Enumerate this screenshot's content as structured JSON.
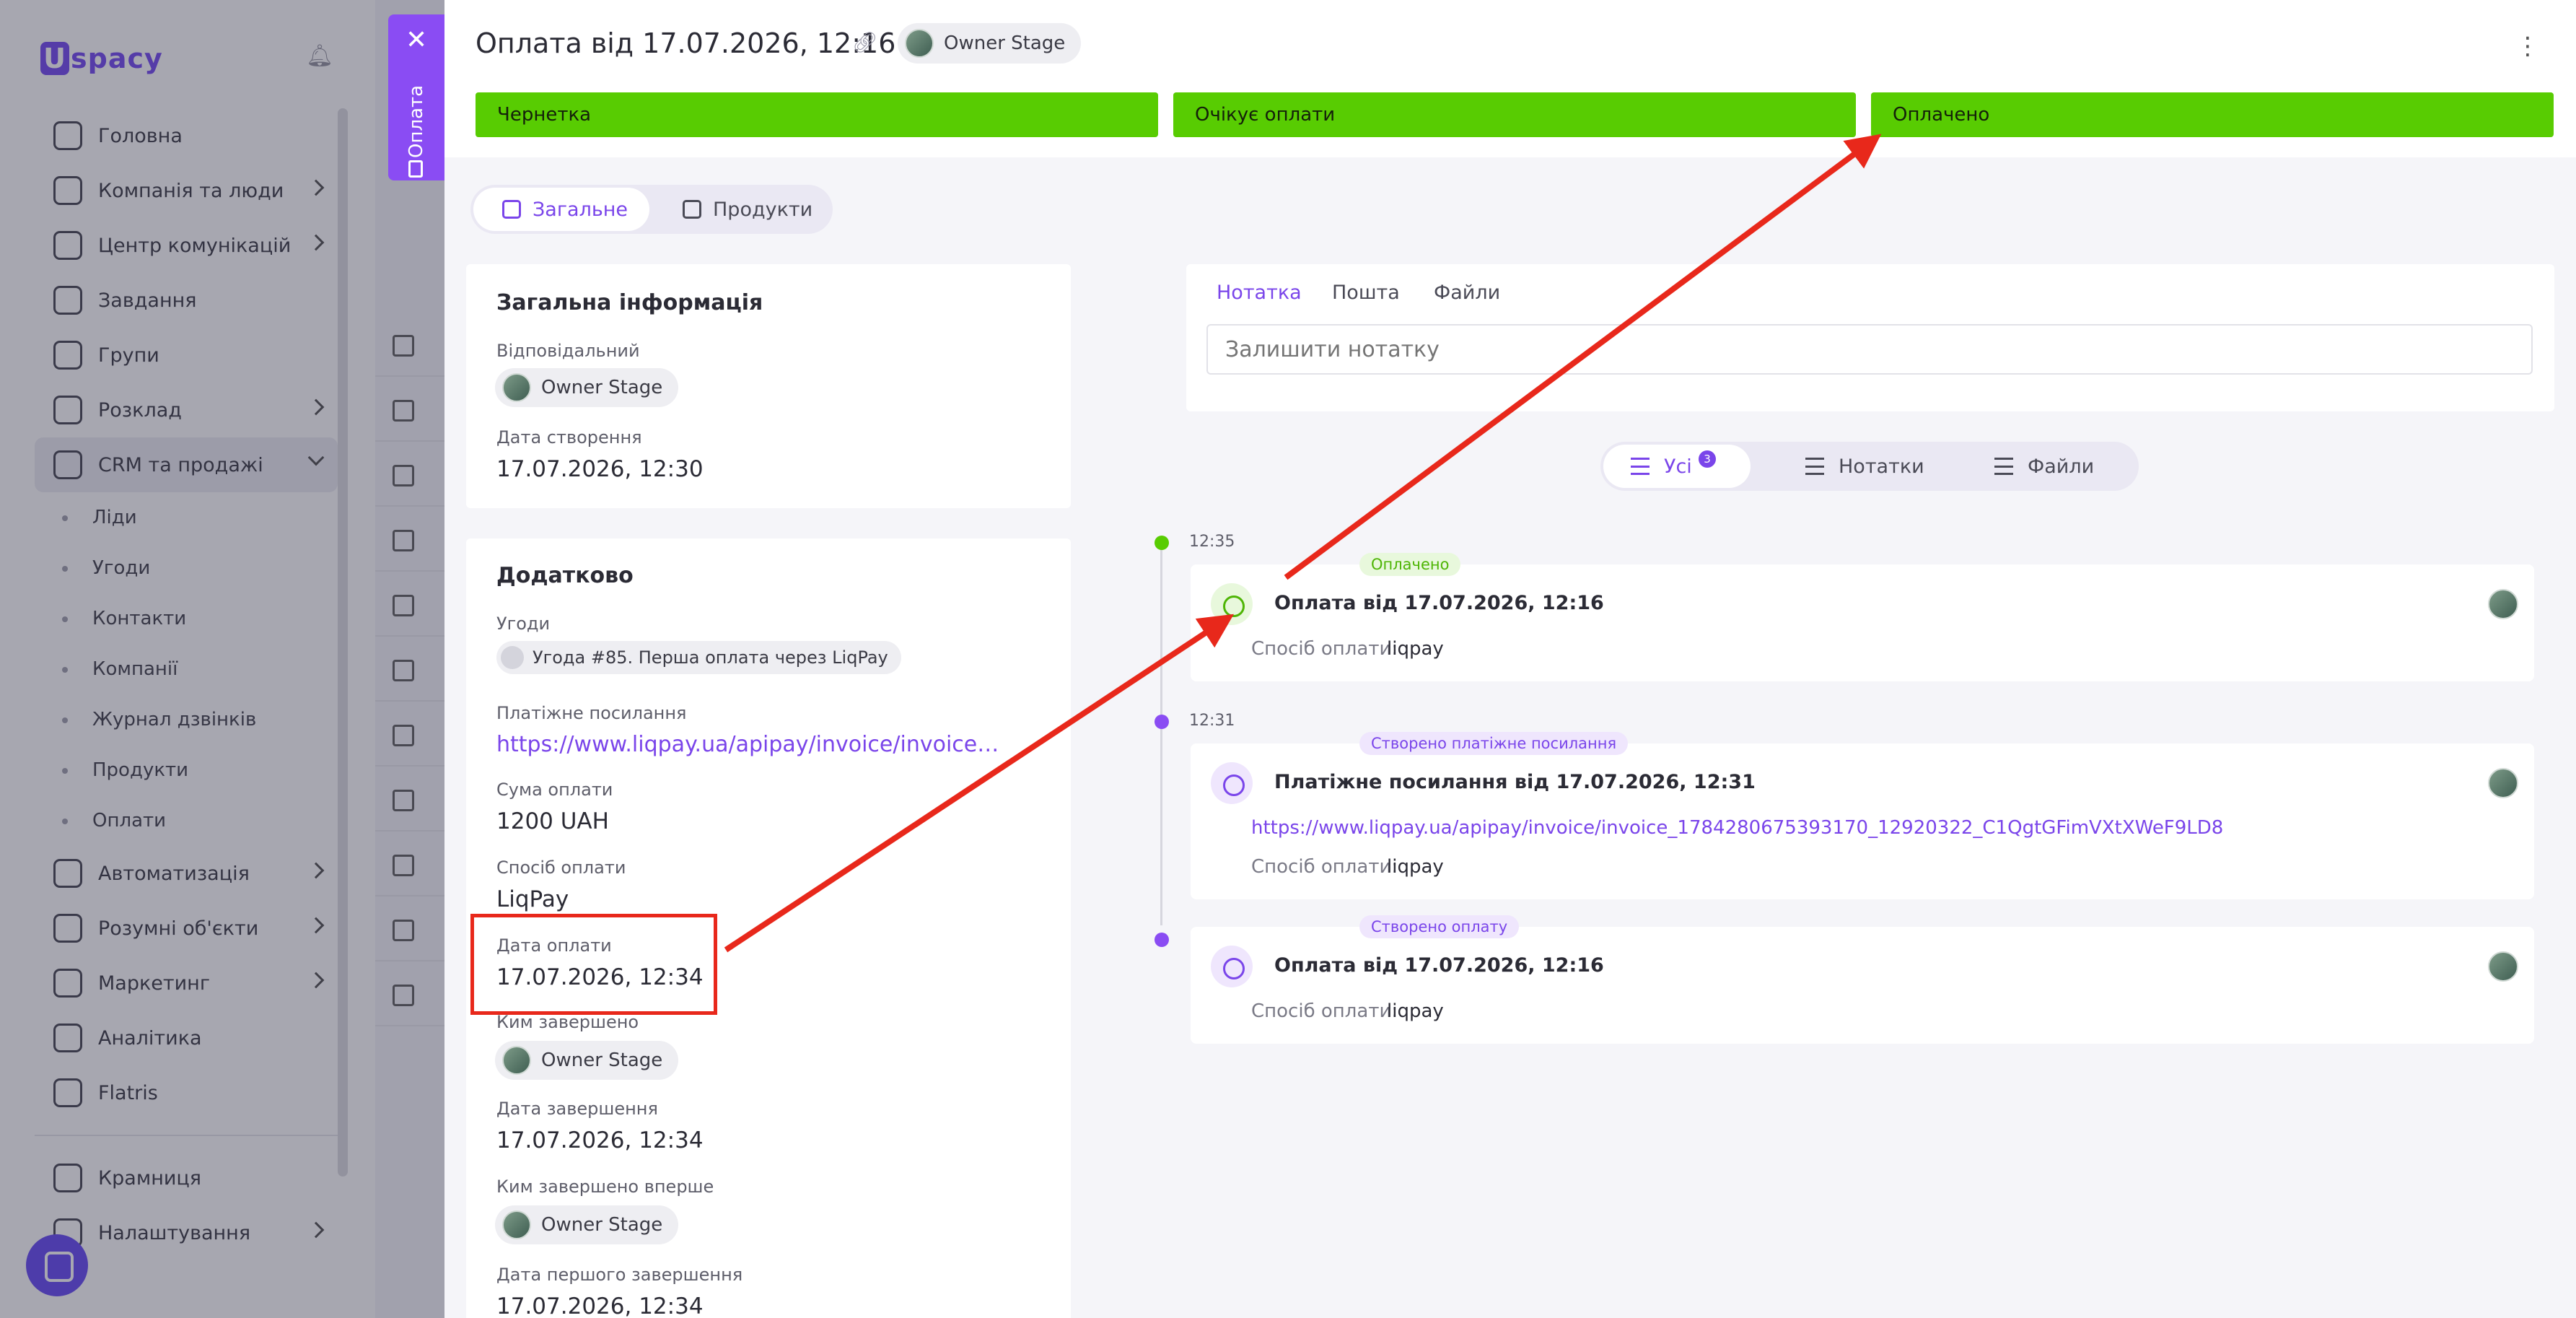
{
  "app": {
    "logo": "spacy",
    "logo_mark": "U",
    "sidebar": {
      "items": [
        {
          "label": "Головна",
          "icon": "home-icon"
        },
        {
          "label": "Компанія та люди",
          "icon": "company-icon"
        },
        {
          "label": "Центр комунікацій",
          "icon": "chat-icon"
        },
        {
          "label": "Завдання",
          "icon": "check-circle-icon"
        },
        {
          "label": "Групи",
          "icon": "users-icon"
        },
        {
          "label": "Розклад",
          "icon": "calendar-icon"
        },
        {
          "label": "CRM та продажі",
          "icon": "database-icon"
        }
      ],
      "crm_subitems": [
        "Ліди",
        "Угоди",
        "Контакти",
        "Компанії",
        "Журнал дзвінків",
        "Продукти",
        "Оплати"
      ],
      "items_after": [
        {
          "label": "Автоматизація",
          "icon": "lightning-icon"
        },
        {
          "label": "Розумні об'єкти",
          "icon": "smart-object-icon"
        },
        {
          "label": "Маркетинг",
          "icon": "megaphone-icon"
        },
        {
          "label": "Аналітика",
          "icon": "chart-icon"
        },
        {
          "label": "Flatris",
          "icon": "grid-icon"
        }
      ],
      "shop": "Крамниця",
      "settings": "Налаштування"
    }
  },
  "side_tab": {
    "label": "Оплата",
    "close": "✕"
  },
  "header": {
    "title": "Оплата від 17.07.2026, 12:16",
    "owner": "Owner Stage",
    "menu": "⋮"
  },
  "stages": [
    "Чернетка",
    "Очікує оплати",
    "Оплачено"
  ],
  "view_tabs": [
    "Загальне",
    "Продукти"
  ],
  "general_info": {
    "title": "Загальна інформація",
    "responsible_label": "Відповідальний",
    "responsible": "Owner Stage",
    "created_label": "Дата створення",
    "created": "17.07.2026, 12:30"
  },
  "extra": {
    "title": "Додатково",
    "deals_label": "Угоди",
    "deal": "Угода #85. Перша оплата через LiqPay",
    "pay_link_label": "Платіжне посилання",
    "pay_link": "https://www.liqpay.ua/apipay/invoice/invoice_1784280675393170_12920322_C1QgtGFimVXtXWeF9LD8",
    "amount_label": "Сума оплати",
    "amount": "1200 UAH",
    "method_label": "Спосіб оплати",
    "method": "LiqPay",
    "pay_date_label": "Дата оплати",
    "pay_date": "17.07.2026, 12:34",
    "completed_by_label": "Ким завершено",
    "completed_by": "Owner Stage",
    "completed_date_label": "Дата завершення",
    "completed_date": "17.07.2026, 12:34",
    "first_completed_by_label": "Ким завершено вперше",
    "first_completed_by": "Owner Stage",
    "first_completed_date_label": "Дата першого завершення",
    "first_completed_date": "17.07.2026, 12:34"
  },
  "note": {
    "tabs": [
      "Нотатка",
      "Пошта",
      "Файли"
    ],
    "placeholder": "Залишити нотатку"
  },
  "filters": {
    "all": "Усі",
    "all_count": "3",
    "notes": "Нотатки",
    "files": "Файли"
  },
  "timeline": [
    {
      "time": "12:35",
      "tag": "Оплачено",
      "title": "Оплата від 17.07.2026, 12:16",
      "method_label": "Спосіб оплати:",
      "method": "liqpay"
    },
    {
      "time": "12:31",
      "tag": "Створено платіжне посилання",
      "title": "Платіжне посилання від 17.07.2026, 12:31",
      "link": "https://www.liqpay.ua/apipay/invoice/invoice_1784280675393170_12920322_C1QgtGFimVXtXWeF9LD8",
      "method_label": "Спосіб оплати:",
      "method": "liqpay"
    },
    {
      "tag": "Створено оплату",
      "title": "Оплата від 17.07.2026, 12:16",
      "method_label": "Спосіб оплати:",
      "method": "liqpay"
    }
  ],
  "colors": {
    "accent": "#7a45ea",
    "stage": "#58cc02",
    "highlight": "#e8281b",
    "side_tab": "#8a4cf3"
  }
}
